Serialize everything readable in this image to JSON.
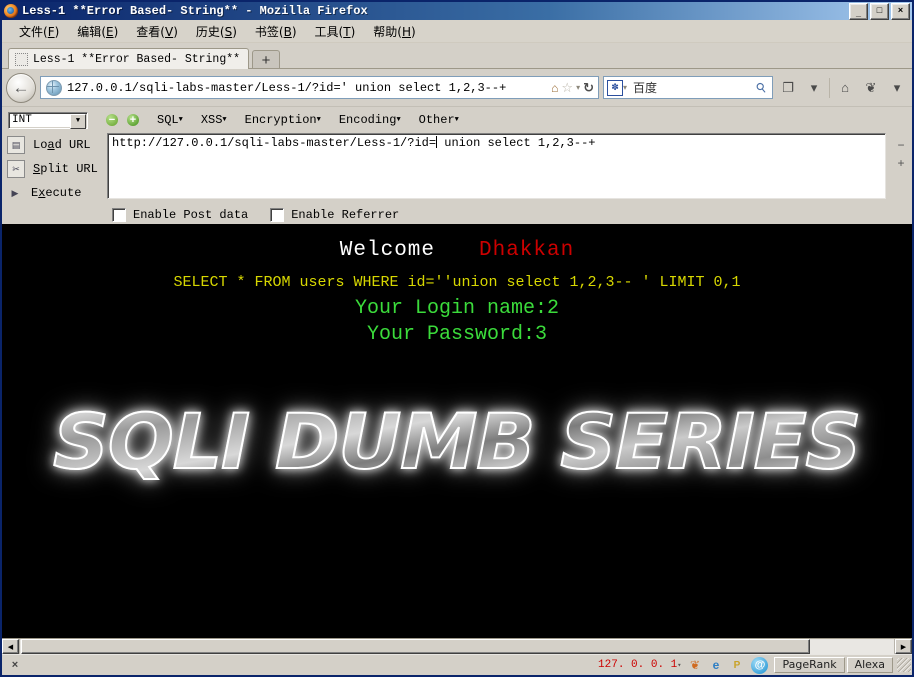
{
  "window": {
    "title": "Less-1 **Error Based- String** - Mozilla Firefox",
    "minimize_label": "_",
    "maximize_label": "□",
    "close_label": "×"
  },
  "menubar": {
    "items": [
      {
        "name": "file",
        "label": "文件",
        "acc": "F"
      },
      {
        "name": "edit",
        "label": "编辑",
        "acc": "E"
      },
      {
        "name": "view",
        "label": "查看",
        "acc": "V"
      },
      {
        "name": "history",
        "label": "历史",
        "acc": "S"
      },
      {
        "name": "bookmarks",
        "label": "书签",
        "acc": "B"
      },
      {
        "name": "tools",
        "label": "工具",
        "acc": "T"
      },
      {
        "name": "help",
        "label": "帮助",
        "acc": "H"
      }
    ]
  },
  "tabbar": {
    "tab_title": "Less-1 **Error Based- String**",
    "new_tab_label": "+"
  },
  "navbar": {
    "back_label": "←",
    "url_value": "127.0.0.1/sqli-labs-master/Less-1/?id=' union select 1,2,3--+",
    "home_small": "⌂",
    "star": "☆",
    "caret": "▾",
    "reload": "↻",
    "search_engine": "百度",
    "search_icon": "✽",
    "magnifier": "⚲",
    "reader_icon": "❐",
    "dropdown_icon": "▾",
    "home_icon": "⌂",
    "addon_icon": "❦",
    "overflow_icon": "▾"
  },
  "hackbar": {
    "type_select": "INT",
    "select_arrow": "▼",
    "minus_label": "−",
    "plus_label": "+",
    "menus": [
      {
        "name": "sql",
        "label": "SQL"
      },
      {
        "name": "xss",
        "label": "XSS"
      },
      {
        "name": "encryption",
        "label": "Encryption"
      },
      {
        "name": "encoding",
        "label": "Encoding"
      },
      {
        "name": "other",
        "label": "Other"
      }
    ],
    "buttons": [
      {
        "name": "load-url",
        "pre": "Lo",
        "acc": "a",
        "post": "d URL",
        "icon": "▤"
      },
      {
        "name": "split-url",
        "pre": "",
        "acc": "S",
        "post": "plit URL",
        "icon": "✂"
      },
      {
        "name": "execute",
        "pre": "E",
        "acc": "x",
        "post": "ecute",
        "icon": "▶"
      }
    ],
    "textarea_before": "http://127.0.0.1/sqli-labs-master/Less-1/?id=",
    "textarea_after": " union select 1,2,3--+",
    "zoom_out": "−",
    "zoom_in": "+",
    "checkboxes": [
      {
        "name": "enable-post-data",
        "label": "Enable Post data"
      },
      {
        "name": "enable-referrer",
        "label": "Enable Referrer"
      }
    ]
  },
  "page": {
    "welcome": "Welcome",
    "welcome_name": "Dhakkan",
    "sql_query": "SELECT * FROM users WHERE id=''union select 1,2,3-- ' LIMIT 0,1",
    "login_name": "Your Login name:2",
    "password": "Your Password:3",
    "logo": "SQLI DUMB SERIES",
    "colors": {
      "welcome": "#ffffff",
      "name": "#cc0000",
      "query": "#d7d700",
      "result": "#3bdb3b",
      "background": "#000000"
    }
  },
  "scrollbar": {
    "left_arrow": "◀",
    "right_arrow": "▶"
  },
  "statusbar": {
    "close_label": "×",
    "ip": "127. 0. 0. 1",
    "ip_caret": "▾",
    "icons": [
      {
        "name": "firefox-addon-icon",
        "glyph": "❦",
        "cls": "fox"
      },
      {
        "name": "ie-tab-icon",
        "glyph": "e",
        "cls": "ie"
      },
      {
        "name": "pagerank-dot-icon",
        "glyph": "P",
        "cls": "p"
      }
    ],
    "at_icon": "@",
    "buttons": [
      {
        "name": "pagerank-button",
        "label": "PageRank"
      },
      {
        "name": "alexa-button",
        "label": "Alexa"
      }
    ]
  }
}
